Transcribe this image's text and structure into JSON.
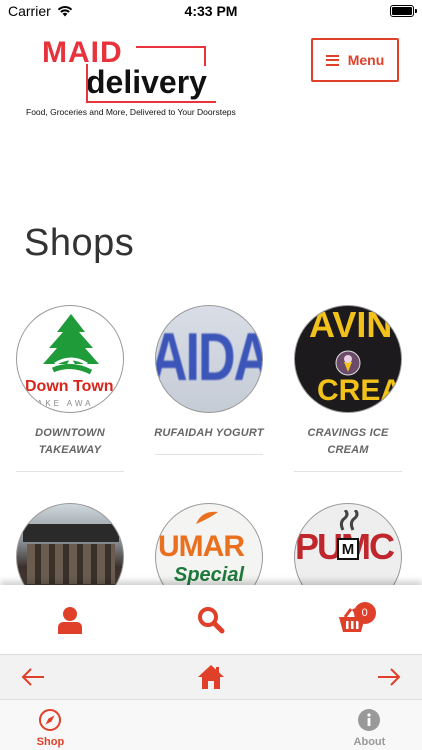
{
  "status_bar": {
    "carrier": "Carrier",
    "time": "4:33 PM"
  },
  "header": {
    "logo_word1": "MAID",
    "logo_word2": "delivery",
    "tagline": "Food, Groceries and More, Delivered to Your Doorsteps",
    "menu_label": "Menu"
  },
  "page": {
    "title": "Shops"
  },
  "shops": [
    {
      "name": "DOWNTOWN TAKEAWAY",
      "logo_text": "Down Town",
      "logo_sub": "AKE AWA"
    },
    {
      "name": "RUFAIDAH YOGURT",
      "logo_text": "AIDAH"
    },
    {
      "name": "CRAVINGS ICE CREAM",
      "logo_text": "AVIN",
      "logo_sub": "CREA"
    },
    {
      "name": "",
      "logo_text": ""
    },
    {
      "name": "",
      "logo_text": "UMAR",
      "logo_sub": "Special"
    },
    {
      "name": "",
      "logo_text": "PUMC",
      "logo_sub": "M"
    }
  ],
  "action_bar": {
    "cart_count": "0"
  },
  "tab_bar": {
    "shop_label": "Shop",
    "about_label": "About"
  },
  "colors": {
    "accent": "#e0402a",
    "brand_red": "#e8333c",
    "tab_inactive": "#999999"
  },
  "icons": {
    "profile": "user-icon",
    "search": "search-icon",
    "cart": "basket-icon",
    "back": "arrow-left-icon",
    "home": "home-icon",
    "forward": "arrow-right-icon",
    "shop_tab": "compass-icon",
    "about_tab": "info-icon"
  }
}
